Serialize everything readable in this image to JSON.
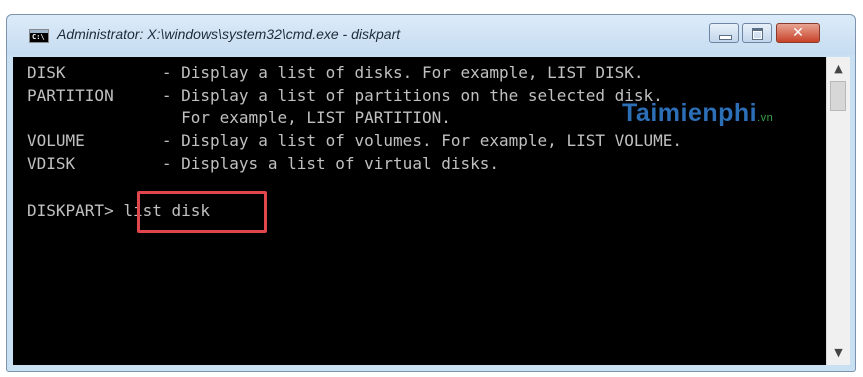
{
  "window": {
    "title": "Administrator: X:\\windows\\system32\\cmd.exe - diskpart",
    "icon_name": "cmd-icon",
    "icon_text": "C:\\"
  },
  "controls": {
    "minimize_icon": "minimize-icon",
    "maximize_icon": "maximize-icon",
    "close_glyph": "✕"
  },
  "console": {
    "lines": [
      "DISK          - Display a list of disks. For example, LIST DISK.",
      "PARTITION     - Display a list of partitions on the selected disk.",
      "                For example, LIST PARTITION.",
      "VOLUME        - Display a list of volumes. For example, LIST VOLUME.",
      "VDISK         - Displays a list of virtual disks.",
      "",
      "DISKPART> list disk"
    ],
    "highlight_color": "#e0474c"
  },
  "scrollbar": {
    "up_glyph": "▲",
    "down_glyph": "▼"
  },
  "watermark": {
    "text": "Taimienphi",
    "suffix": ".vn"
  }
}
